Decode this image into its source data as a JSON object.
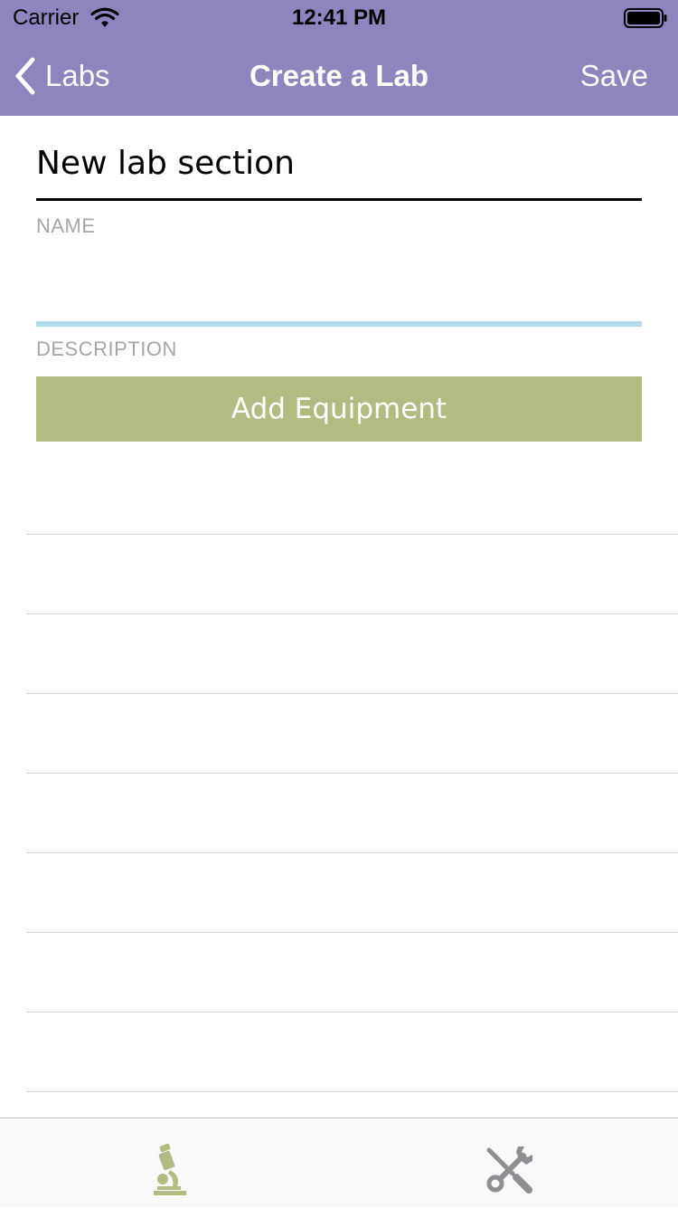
{
  "colors": {
    "accent": "#8f84bd",
    "button": "#b1bc83",
    "tab_active": "#b1bc83",
    "tab_inactive": "#8e8e93",
    "input_underline": "#b2ddec"
  },
  "status_bar": {
    "carrier": "Carrier",
    "time": "12:41 PM",
    "icons": [
      "wifi-icon",
      "battery-icon"
    ]
  },
  "nav": {
    "back_label": "Labs",
    "title": "Create a Lab",
    "save_label": "Save"
  },
  "form": {
    "section_title": "New lab section",
    "name_label": "NAME",
    "name_value": "",
    "description_label": "DESCRIPTION",
    "add_button_label": "Add Equipment"
  },
  "equipment_rows": [
    "",
    "",
    "",
    "",
    "",
    "",
    "",
    "",
    ""
  ],
  "tabs": [
    {
      "icon": "microscope-icon",
      "active": true
    },
    {
      "icon": "tools-icon",
      "active": false
    }
  ]
}
